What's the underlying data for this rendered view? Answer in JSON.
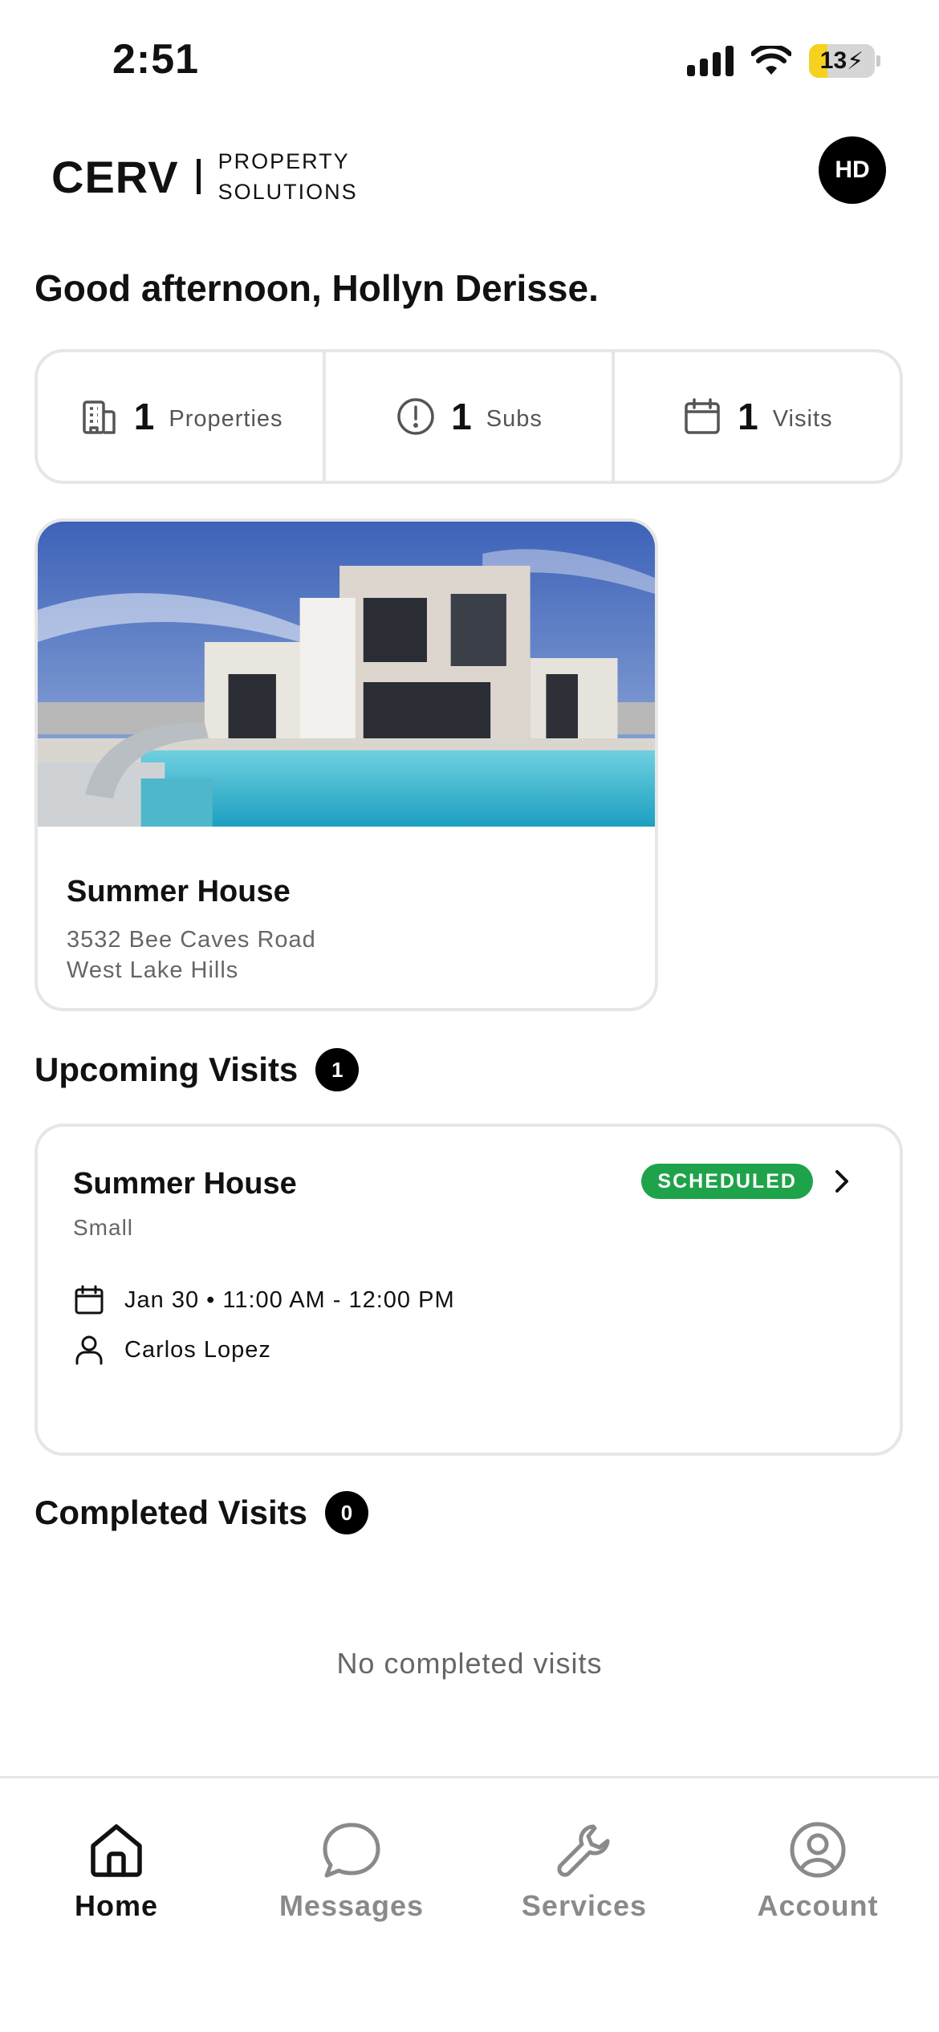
{
  "status_bar": {
    "time": "2:51",
    "battery": "13"
  },
  "header": {
    "brand_name": "CERV",
    "brand_sub_line1": "PROPERTY",
    "brand_sub_line2": "SOLUTIONS",
    "avatar_initials": "HD"
  },
  "greeting": "Good afternoon, Hollyn Derisse.",
  "stats": [
    {
      "icon": "building-icon",
      "count": "1",
      "label": "Properties"
    },
    {
      "icon": "alert-circle-icon",
      "count": "1",
      "label": "Subs"
    },
    {
      "icon": "calendar-icon",
      "count": "1",
      "label": "Visits"
    }
  ],
  "property": {
    "name": "Summer House",
    "address_line1": "3532 Bee Caves Road",
    "address_line2": "West Lake Hills"
  },
  "upcoming": {
    "title": "Upcoming Visits",
    "count": "1",
    "visit": {
      "title": "Summer House",
      "size": "Small",
      "status": "SCHEDULED",
      "datetime": "Jan 30 • 11:00 AM - 12:00 PM",
      "person": "Carlos Lopez"
    }
  },
  "completed": {
    "title": "Completed Visits",
    "count": "0",
    "empty_text": "No completed visits"
  },
  "tabs": [
    {
      "label": "Home",
      "icon": "home-icon",
      "active": true
    },
    {
      "label": "Messages",
      "icon": "chat-icon",
      "active": false
    },
    {
      "label": "Services",
      "icon": "wrench-icon",
      "active": false
    },
    {
      "label": "Account",
      "icon": "account-icon",
      "active": false
    }
  ],
  "colors": {
    "accent_green": "#1fa34a",
    "text": "#111111",
    "muted": "#666666",
    "border": "#e6e6e6"
  }
}
